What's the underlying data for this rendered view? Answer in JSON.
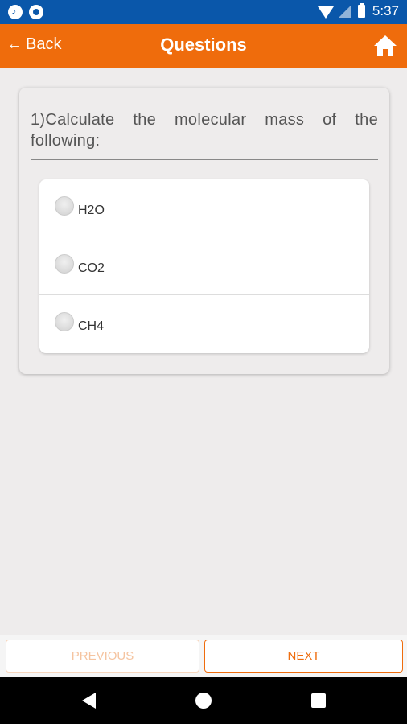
{
  "status_bar": {
    "time": "5:37"
  },
  "app_bar": {
    "back_label": "Back",
    "title": "Questions"
  },
  "question": {
    "text": "1)Calculate the molecular mass of the following:",
    "options": [
      {
        "label": "H2O",
        "selected": false
      },
      {
        "label": "CO2",
        "selected": false
      },
      {
        "label": "CH4",
        "selected": false
      }
    ]
  },
  "footer": {
    "previous_label": "PREVIOUS",
    "next_label": "NEXT"
  },
  "colors": {
    "accent": "#ef6c0c",
    "status_bar": "#0a57aa"
  }
}
